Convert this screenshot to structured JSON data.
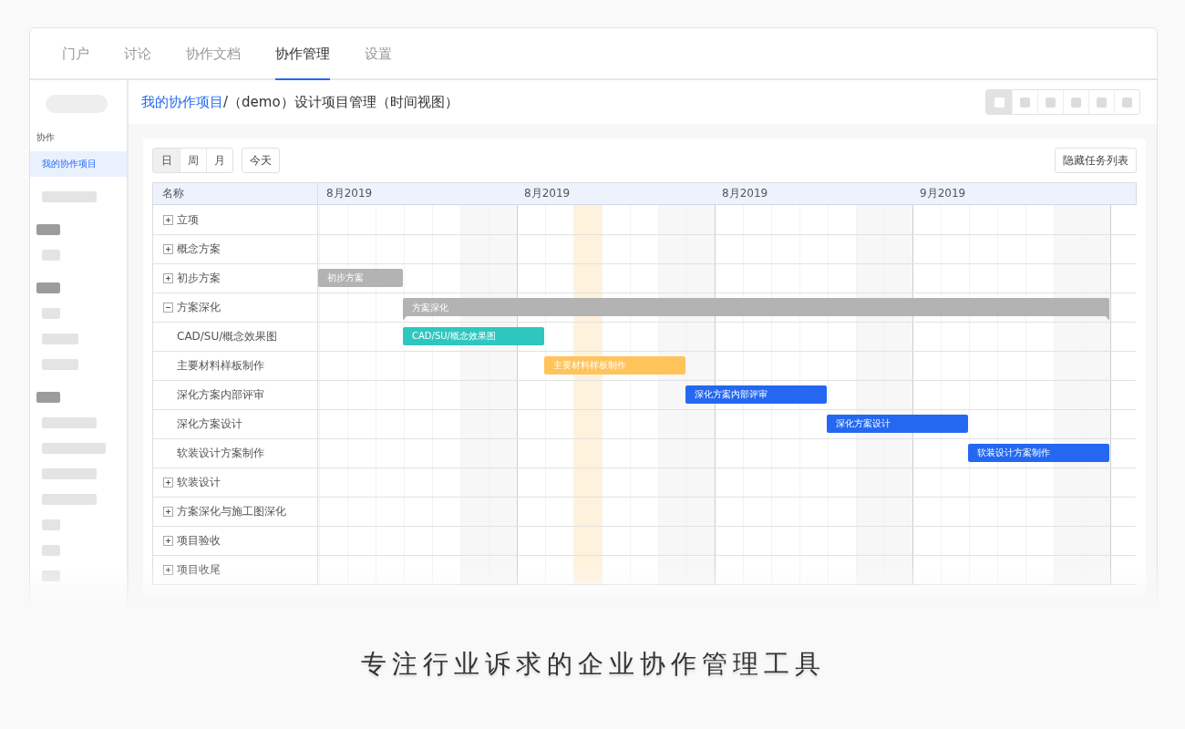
{
  "tabs": [
    {
      "label": "门户",
      "selected": false
    },
    {
      "label": "讨论",
      "selected": false
    },
    {
      "label": "协作文档",
      "selected": false
    },
    {
      "label": "协作管理",
      "selected": true
    },
    {
      "label": "设置",
      "selected": false
    }
  ],
  "sidebar": {
    "section": "协作",
    "items": [
      {
        "label": "我的协作项目",
        "selected": true
      }
    ],
    "skeleton": [
      {
        "kind": "item"
      },
      {
        "kind": "heading"
      },
      {
        "kind": "item"
      },
      {
        "kind": "heading"
      },
      {
        "kind": "item"
      },
      {
        "kind": "item"
      },
      {
        "kind": "item"
      },
      {
        "kind": "heading"
      },
      {
        "kind": "item"
      },
      {
        "kind": "item"
      },
      {
        "kind": "item"
      },
      {
        "kind": "item"
      },
      {
        "kind": "item"
      },
      {
        "kind": "item"
      },
      {
        "kind": "item"
      }
    ]
  },
  "breadcrumb": {
    "link": "我的协作项目",
    "rest": "/（demo）设计项目管理（时间视图）"
  },
  "view_buttons": [
    {
      "selected": true
    },
    {
      "selected": false
    },
    {
      "selected": false
    },
    {
      "selected": false
    },
    {
      "selected": false
    },
    {
      "selected": false
    }
  ],
  "toolbar": {
    "scales": [
      {
        "label": "日",
        "selected": true
      },
      {
        "label": "周",
        "selected": false
      },
      {
        "label": "月",
        "selected": false
      }
    ],
    "today": "今天",
    "hide_list": "隐藏任务列表"
  },
  "gantt": {
    "name_header": "名称",
    "months": [
      "8月2019",
      "8月2019",
      "8月2019",
      "9月2019"
    ],
    "days": [
      {
        "kind": "weekday",
        "week_start": false
      },
      {
        "kind": "weekday",
        "week_start": false
      },
      {
        "kind": "weekday",
        "week_start": false
      },
      {
        "kind": "weekday",
        "week_start": false
      },
      {
        "kind": "weekday",
        "week_start": false
      },
      {
        "kind": "weekend",
        "week_start": false
      },
      {
        "kind": "weekend",
        "week_start": false
      },
      {
        "kind": "weekday",
        "week_start": true
      },
      {
        "kind": "weekday",
        "week_start": false
      },
      {
        "kind": "today",
        "week_start": false
      },
      {
        "kind": "weekday",
        "week_start": false
      },
      {
        "kind": "weekday",
        "week_start": false
      },
      {
        "kind": "weekend",
        "week_start": false
      },
      {
        "kind": "weekend",
        "week_start": false
      },
      {
        "kind": "weekday",
        "week_start": true
      },
      {
        "kind": "weekday",
        "week_start": false
      },
      {
        "kind": "weekday",
        "week_start": false
      },
      {
        "kind": "weekday",
        "week_start": false
      },
      {
        "kind": "weekday",
        "week_start": false
      },
      {
        "kind": "weekend",
        "week_start": false
      },
      {
        "kind": "weekend",
        "week_start": false
      },
      {
        "kind": "weekday",
        "week_start": true
      },
      {
        "kind": "weekday",
        "week_start": false
      },
      {
        "kind": "weekday",
        "week_start": false
      },
      {
        "kind": "weekday",
        "week_start": false
      },
      {
        "kind": "weekday",
        "week_start": false
      },
      {
        "kind": "weekend",
        "week_start": false
      },
      {
        "kind": "weekend",
        "week_start": false
      },
      {
        "kind": "weekday",
        "week_start": true
      }
    ],
    "rows": [
      {
        "name": "立项",
        "expanded": false
      },
      {
        "name": "概念方案",
        "expanded": false
      },
      {
        "name": "初步方案",
        "expanded": false,
        "bar": {
          "label": "初步方案",
          "color": "#b3b3b3"
        }
      },
      {
        "name": "方案深化",
        "expanded": true,
        "bar": {
          "label": "方案深化",
          "color": "#b3b3b3"
        },
        "children": [
          {
            "name": "CAD/SU/概念效果图",
            "bar": {
              "label": "CAD/SU/概念效果图",
              "color": "#2ec7c0"
            }
          },
          {
            "name": "主要材料样板制作",
            "bar": {
              "label": "主要材料样板制作",
              "color": "#ffc35c"
            }
          },
          {
            "name": "深化方案内部评审",
            "bar": {
              "label": "深化方案内部评审",
              "color": "#2468f2"
            }
          },
          {
            "name": "深化方案设计",
            "bar": {
              "label": "深化方案设计",
              "color": "#2468f2"
            }
          },
          {
            "name": "软装设计方案制作",
            "bar": {
              "label": "软装设计方案制作",
              "color": "#2468f2"
            }
          }
        ]
      },
      {
        "name": "软装设计",
        "expanded": false
      },
      {
        "name": "方案深化与施工图深化",
        "expanded": false
      },
      {
        "name": "项目验收",
        "expanded": false
      },
      {
        "name": "项目收尾",
        "expanded": false
      }
    ]
  },
  "caption": "专注行业诉求的企业协作管理工具"
}
